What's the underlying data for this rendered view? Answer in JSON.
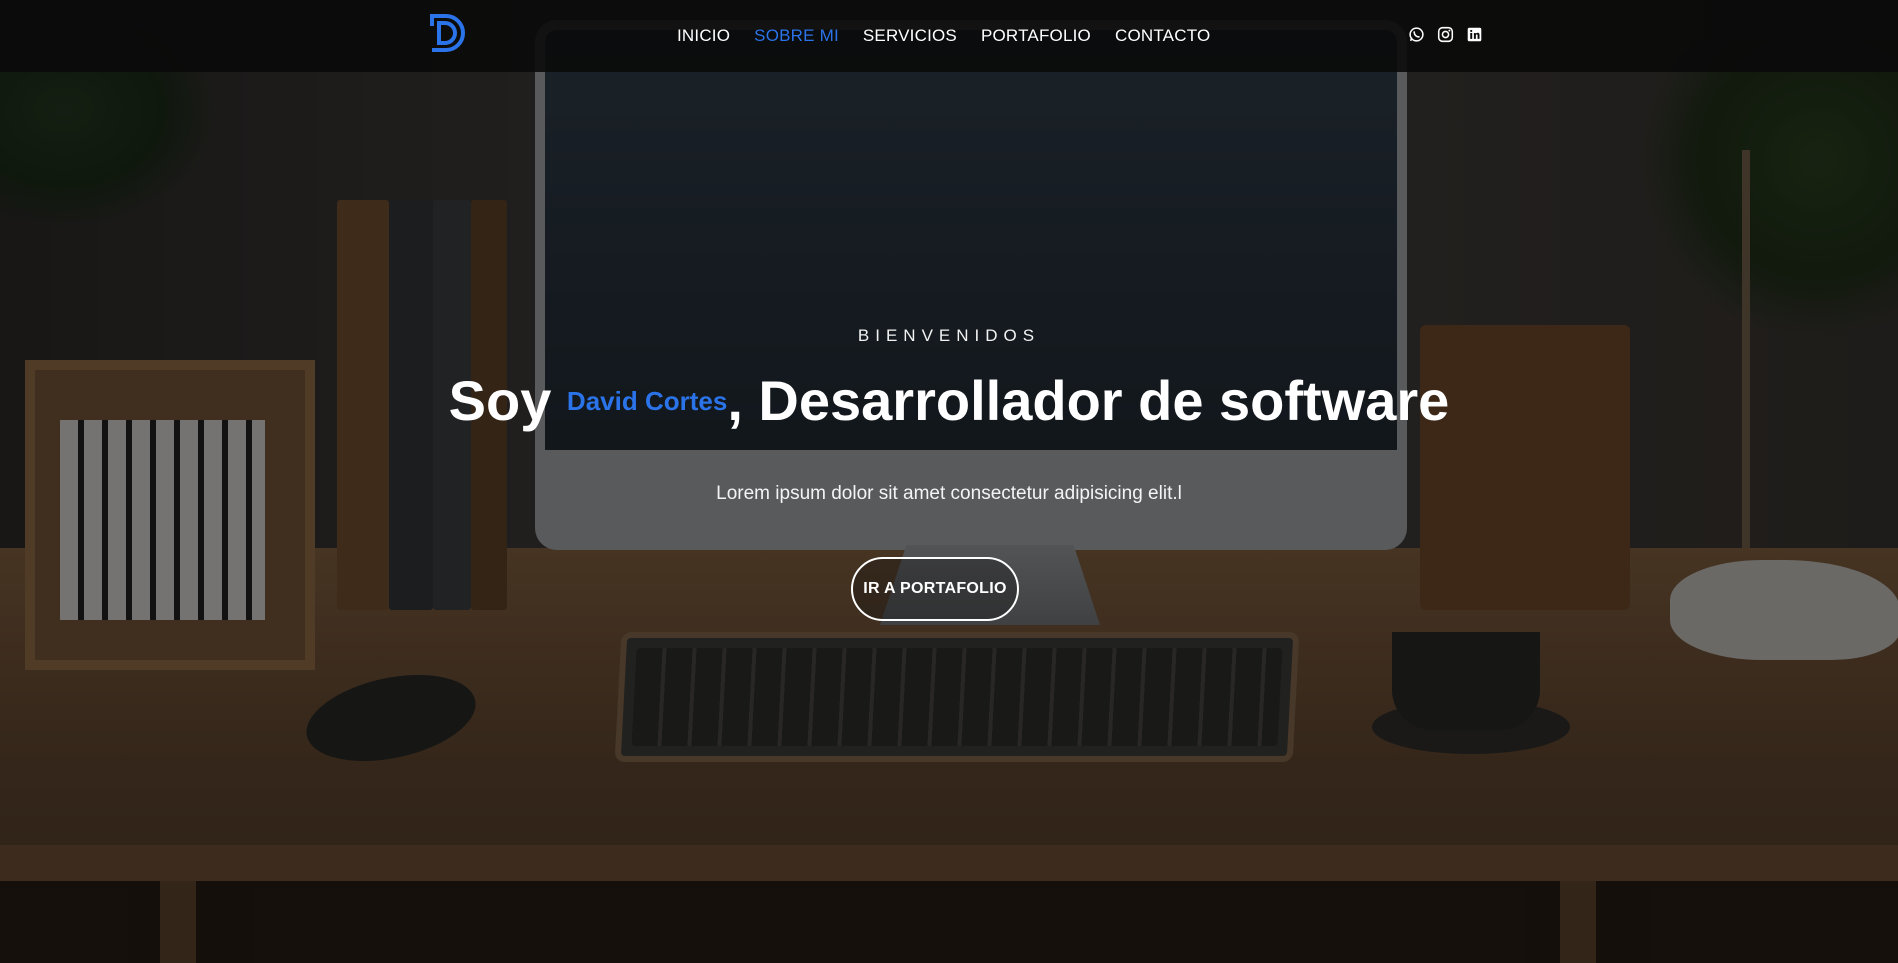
{
  "brand": {
    "logo_icon": "d-logo-icon",
    "accent_color": "#2b73e8"
  },
  "nav": {
    "items": [
      {
        "label": "INICIO",
        "active": false
      },
      {
        "label": "SOBRE MI",
        "active": true
      },
      {
        "label": "SERVICIOS",
        "active": false
      },
      {
        "label": "PORTAFOLIO",
        "active": false
      },
      {
        "label": "CONTACTO",
        "active": false
      }
    ]
  },
  "social": {
    "icons": [
      "whatsapp-icon",
      "instagram-icon",
      "linkedin-icon"
    ]
  },
  "hero": {
    "welcome": "BIENVENIDOS",
    "headline_prefix": "Soy ",
    "name": "David Cortes",
    "headline_suffix": ", Desarrollador de software",
    "subtitle": "Lorem ipsum dolor sit amet consectetur adipisicing elit.l",
    "cta_label": "IR A PORTAFOLIO"
  }
}
